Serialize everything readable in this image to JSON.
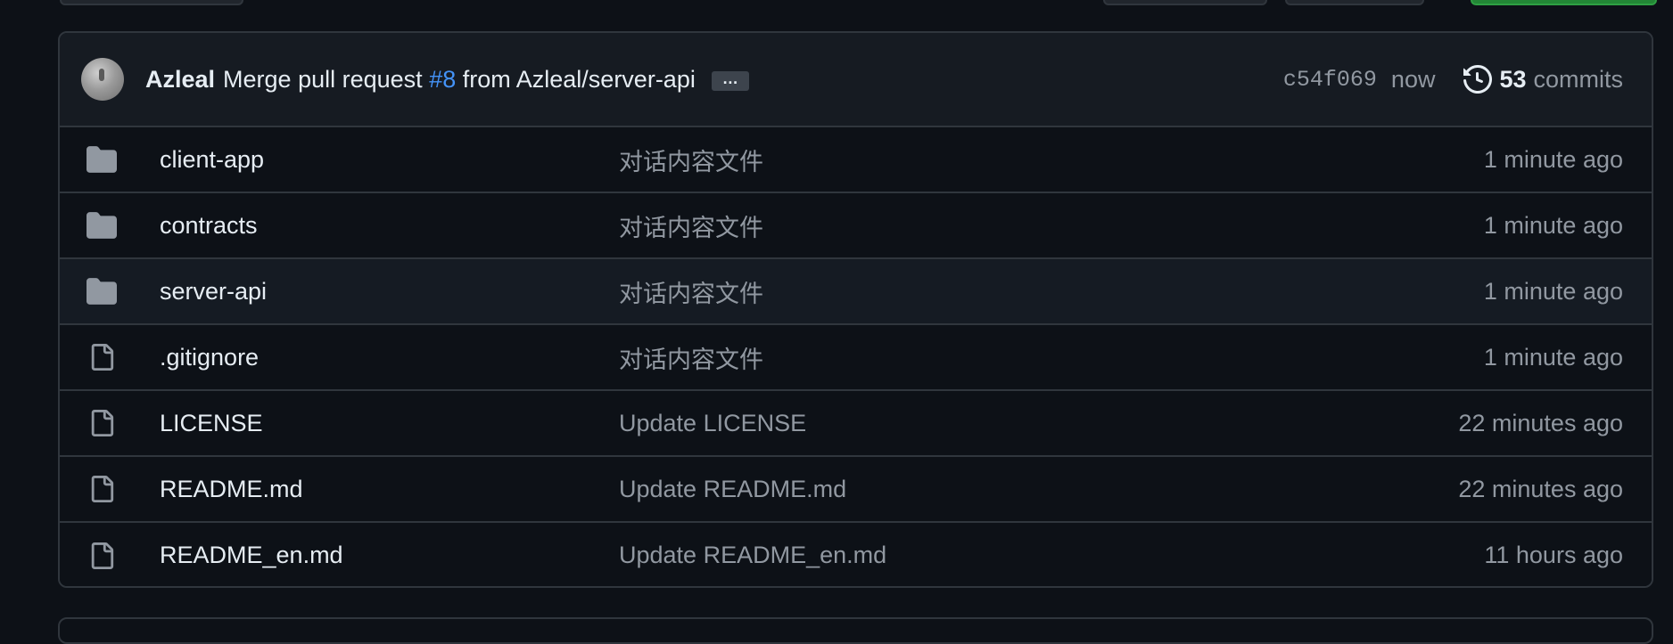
{
  "commit": {
    "author": "Azleal",
    "message_prefix": "Merge pull request",
    "pr_number": "#8",
    "message_suffix": "from Azleal/server-api",
    "expand_label": "…",
    "sha": "c54f069",
    "when": "now",
    "commit_count": "53",
    "commits_label": "commits"
  },
  "files": [
    {
      "name": "client-app",
      "type": "directory",
      "icon": "folder-icon",
      "message": "对话内容文件",
      "age": "1 minute ago"
    },
    {
      "name": "contracts",
      "type": "directory",
      "icon": "folder-icon",
      "message": "对话内容文件",
      "age": "1 minute ago"
    },
    {
      "name": "server-api",
      "type": "directory",
      "icon": "folder-icon",
      "message": "对话内容文件",
      "age": "1 minute ago"
    },
    {
      "name": ".gitignore",
      "type": "file",
      "icon": "file-icon",
      "message": "对话内容文件",
      "age": "1 minute ago"
    },
    {
      "name": "LICENSE",
      "type": "file",
      "icon": "file-icon",
      "message": "Update LICENSE",
      "age": "22 minutes ago"
    },
    {
      "name": "README.md",
      "type": "file",
      "icon": "file-icon",
      "message": "Update README.md",
      "age": "22 minutes ago"
    },
    {
      "name": "README_en.md",
      "type": "file",
      "icon": "file-icon",
      "message": "Update README_en.md",
      "age": "11 hours ago"
    }
  ],
  "colors": {
    "background": "#0d1117",
    "header_bg": "#161b22",
    "border": "#30363d",
    "link": "#4493f8",
    "muted_text": "#9198a1",
    "primary_text": "#e6edf3",
    "folder_icon": "#9198a1"
  }
}
